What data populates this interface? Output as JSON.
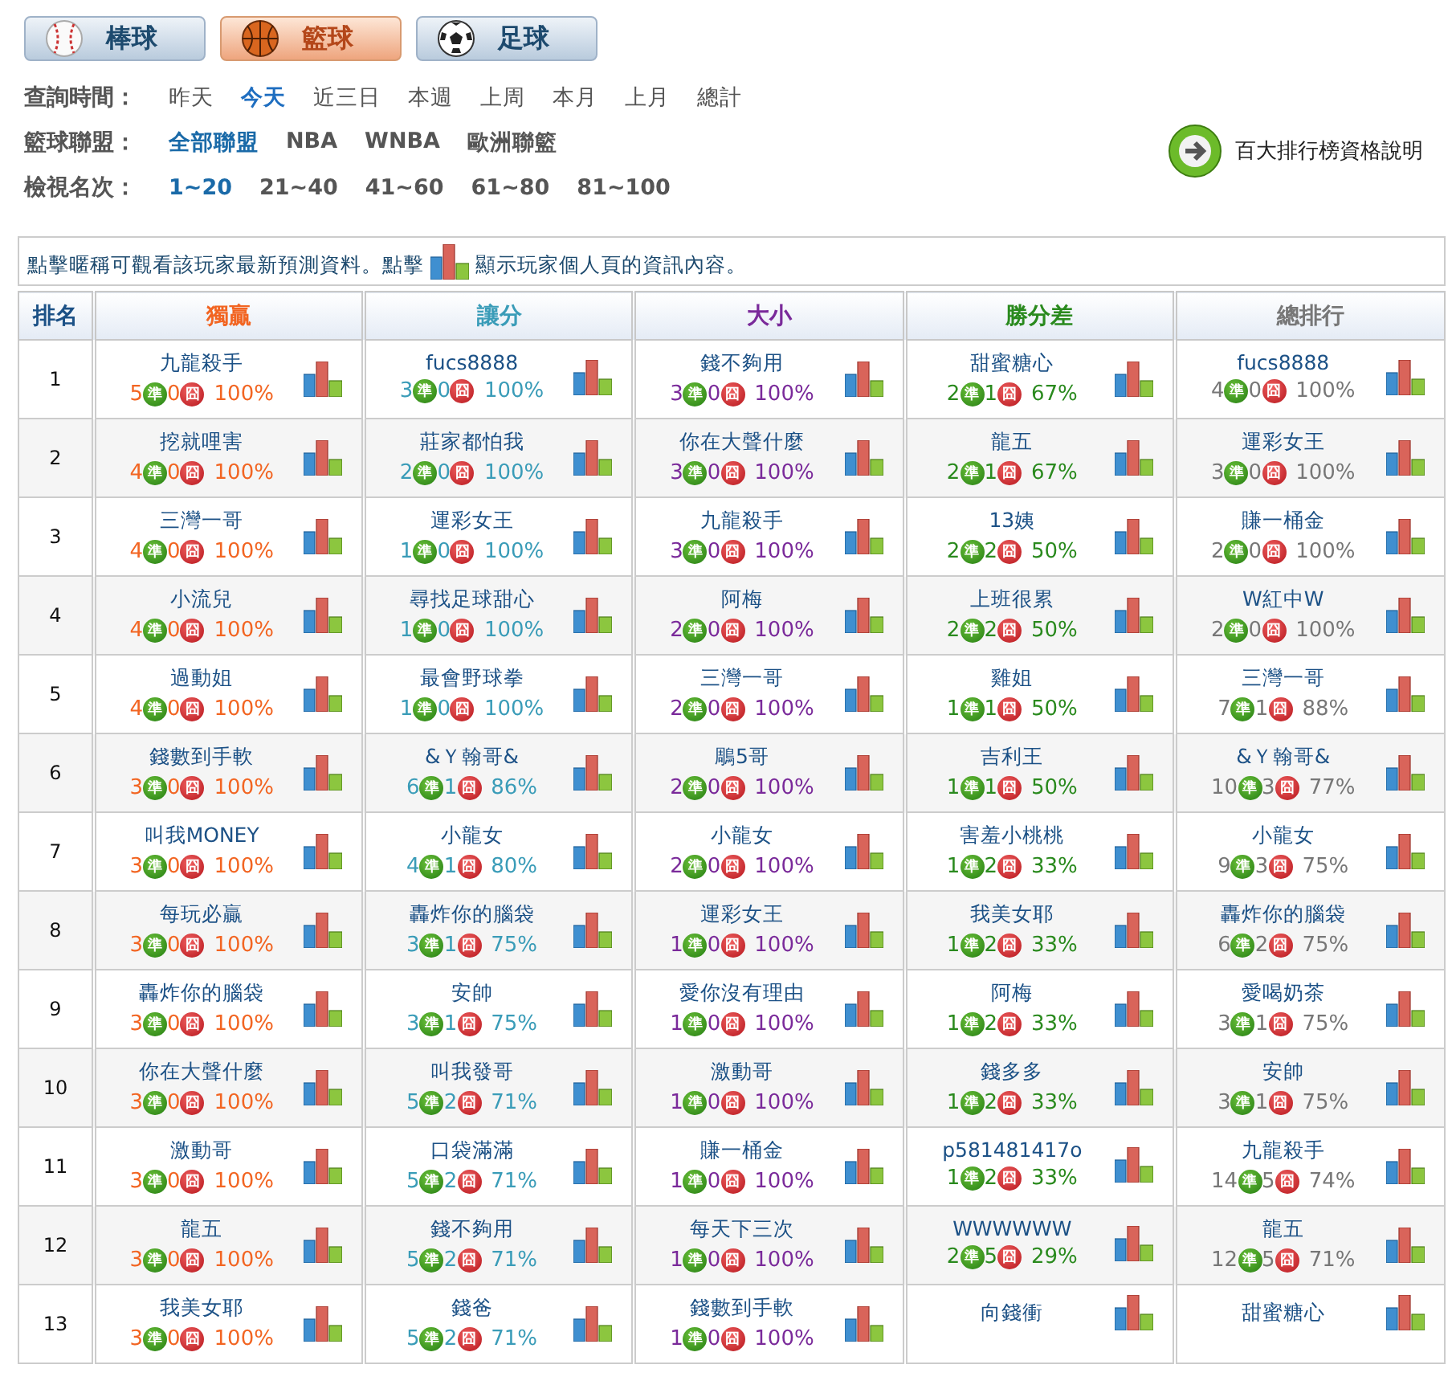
{
  "sport_tabs": [
    {
      "label": "棒球",
      "kind": "baseball",
      "selected": false
    },
    {
      "label": "籃球",
      "kind": "basketball",
      "selected": true
    },
    {
      "label": "足球",
      "kind": "soccer",
      "selected": false
    }
  ],
  "filters": [
    {
      "label": "查詢時間：",
      "kind": "plain",
      "options": [
        {
          "text": "昨天",
          "selected": false
        },
        {
          "text": "今天",
          "selected": true
        },
        {
          "text": "近三日",
          "selected": false
        },
        {
          "text": "本週",
          "selected": false
        },
        {
          "text": "上周",
          "selected": false
        },
        {
          "text": "本月",
          "selected": false
        },
        {
          "text": "上月",
          "selected": false
        },
        {
          "text": "總計",
          "selected": false
        }
      ]
    },
    {
      "label": "籃球聯盟：",
      "kind": "bold",
      "options": [
        {
          "text": "全部聯盟",
          "selected": true
        },
        {
          "text": "NBA",
          "selected": false
        },
        {
          "text": "WNBA",
          "selected": false
        },
        {
          "text": "歐洲聯籃",
          "selected": false
        }
      ]
    },
    {
      "label": "檢視名次：",
      "kind": "bold",
      "options": [
        {
          "text": "1~20",
          "selected": true
        },
        {
          "text": "21~40",
          "selected": false
        },
        {
          "text": "41~60",
          "selected": false
        },
        {
          "text": "61~80",
          "selected": false
        },
        {
          "text": "81~100",
          "selected": false
        }
      ]
    }
  ],
  "info_link": "百大排行榜資格說明",
  "notice": {
    "before": "點擊暱稱可觀看該玩家最新預測資料。點擊",
    "after": "顯示玩家個人頁的資訊內容。"
  },
  "table": {
    "rank_header": "排名",
    "columns": [
      {
        "title": "獨贏",
        "color": "#f26522"
      },
      {
        "title": "讓分",
        "color": "#3a9cb8"
      },
      {
        "title": "大小",
        "color": "#7a2a9a"
      },
      {
        "title": "勝分差",
        "color": "#2a8a1e"
      },
      {
        "title": "總排行",
        "color": "#777777"
      }
    ],
    "rows": [
      {
        "rank": "1",
        "cells": [
          {
            "name": "九龍殺手",
            "win": "5",
            "win_mark": "準",
            "loss": "0",
            "loss_mark": "囧",
            "pct": "100%"
          },
          {
            "name": "fucs8888",
            "win": "3",
            "win_mark": "準",
            "loss": "0",
            "loss_mark": "囧",
            "pct": "100%"
          },
          {
            "name": "錢不夠用",
            "win": "3",
            "win_mark": "準",
            "loss": "0",
            "loss_mark": "囧",
            "pct": "100%"
          },
          {
            "name": "甜蜜糖心",
            "win": "2",
            "win_mark": "準",
            "loss": "1",
            "loss_mark": "囧",
            "pct": "67%"
          },
          {
            "name": "fucs8888",
            "win": "4",
            "win_mark": "準",
            "loss": "0",
            "loss_mark": "囧",
            "pct": "100%"
          }
        ]
      },
      {
        "rank": "2",
        "cells": [
          {
            "name": "挖就哩害",
            "win": "4",
            "win_mark": "準",
            "loss": "0",
            "loss_mark": "囧",
            "pct": "100%"
          },
          {
            "name": "莊家都怕我",
            "win": "2",
            "win_mark": "準",
            "loss": "0",
            "loss_mark": "囧",
            "pct": "100%"
          },
          {
            "name": "你在大聲什麼",
            "win": "3",
            "win_mark": "準",
            "loss": "0",
            "loss_mark": "囧",
            "pct": "100%"
          },
          {
            "name": "龍五",
            "win": "2",
            "win_mark": "準",
            "loss": "1",
            "loss_mark": "囧",
            "pct": "67%"
          },
          {
            "name": "運彩女王",
            "win": "3",
            "win_mark": "準",
            "loss": "0",
            "loss_mark": "囧",
            "pct": "100%"
          }
        ]
      },
      {
        "rank": "3",
        "cells": [
          {
            "name": "三灣一哥",
            "win": "4",
            "win_mark": "準",
            "loss": "0",
            "loss_mark": "囧",
            "pct": "100%"
          },
          {
            "name": "運彩女王",
            "win": "1",
            "win_mark": "準",
            "loss": "0",
            "loss_mark": "囧",
            "pct": "100%"
          },
          {
            "name": "九龍殺手",
            "win": "3",
            "win_mark": "準",
            "loss": "0",
            "loss_mark": "囧",
            "pct": "100%"
          },
          {
            "name": "13姨",
            "win": "2",
            "win_mark": "準",
            "loss": "2",
            "loss_mark": "囧",
            "pct": "50%"
          },
          {
            "name": "賺一桶金",
            "win": "2",
            "win_mark": "準",
            "loss": "0",
            "loss_mark": "囧",
            "pct": "100%"
          }
        ]
      },
      {
        "rank": "4",
        "cells": [
          {
            "name": "小流兒",
            "win": "4",
            "win_mark": "準",
            "loss": "0",
            "loss_mark": "囧",
            "pct": "100%"
          },
          {
            "name": "尋找足球甜心",
            "win": "1",
            "win_mark": "準",
            "loss": "0",
            "loss_mark": "囧",
            "pct": "100%"
          },
          {
            "name": "阿梅",
            "win": "2",
            "win_mark": "準",
            "loss": "0",
            "loss_mark": "囧",
            "pct": "100%"
          },
          {
            "name": "上班很累",
            "win": "2",
            "win_mark": "準",
            "loss": "2",
            "loss_mark": "囧",
            "pct": "50%"
          },
          {
            "name": "W紅中W",
            "win": "2",
            "win_mark": "準",
            "loss": "0",
            "loss_mark": "囧",
            "pct": "100%"
          }
        ]
      },
      {
        "rank": "5",
        "cells": [
          {
            "name": "過動姐",
            "win": "4",
            "win_mark": "準",
            "loss": "0",
            "loss_mark": "囧",
            "pct": "100%"
          },
          {
            "name": "最會野球拳",
            "win": "1",
            "win_mark": "準",
            "loss": "0",
            "loss_mark": "囧",
            "pct": "100%"
          },
          {
            "name": "三灣一哥",
            "win": "2",
            "win_mark": "準",
            "loss": "0",
            "loss_mark": "囧",
            "pct": "100%"
          },
          {
            "name": "雞姐",
            "win": "1",
            "win_mark": "準",
            "loss": "1",
            "loss_mark": "囧",
            "pct": "50%"
          },
          {
            "name": "三灣一哥",
            "win": "7",
            "win_mark": "準",
            "loss": "1",
            "loss_mark": "囧",
            "pct": "88%"
          }
        ]
      },
      {
        "rank": "6",
        "cells": [
          {
            "name": "錢數到手軟",
            "win": "3",
            "win_mark": "準",
            "loss": "0",
            "loss_mark": "囧",
            "pct": "100%"
          },
          {
            "name": "&Ｙ翰哥&",
            "win": "6",
            "win_mark": "準",
            "loss": "1",
            "loss_mark": "囧",
            "pct": "86%"
          },
          {
            "name": "鵰5哥",
            "win": "2",
            "win_mark": "準",
            "loss": "0",
            "loss_mark": "囧",
            "pct": "100%"
          },
          {
            "name": "吉利王",
            "win": "1",
            "win_mark": "準",
            "loss": "1",
            "loss_mark": "囧",
            "pct": "50%"
          },
          {
            "name": "&Ｙ翰哥&",
            "win": "10",
            "win_mark": "準",
            "loss": "3",
            "loss_mark": "囧",
            "pct": "77%"
          }
        ]
      },
      {
        "rank": "7",
        "cells": [
          {
            "name": "叫我MONEY",
            "win": "3",
            "win_mark": "準",
            "loss": "0",
            "loss_mark": "囧",
            "pct": "100%"
          },
          {
            "name": "小龍女",
            "win": "4",
            "win_mark": "準",
            "loss": "1",
            "loss_mark": "囧",
            "pct": "80%"
          },
          {
            "name": "小龍女",
            "win": "2",
            "win_mark": "準",
            "loss": "0",
            "loss_mark": "囧",
            "pct": "100%"
          },
          {
            "name": "害羞小桃桃",
            "win": "1",
            "win_mark": "準",
            "loss": "2",
            "loss_mark": "囧",
            "pct": "33%"
          },
          {
            "name": "小龍女",
            "win": "9",
            "win_mark": "準",
            "loss": "3",
            "loss_mark": "囧",
            "pct": "75%"
          }
        ]
      },
      {
        "rank": "8",
        "cells": [
          {
            "name": "每玩必贏",
            "win": "3",
            "win_mark": "準",
            "loss": "0",
            "loss_mark": "囧",
            "pct": "100%"
          },
          {
            "name": "轟炸你的腦袋",
            "win": "3",
            "win_mark": "準",
            "loss": "1",
            "loss_mark": "囧",
            "pct": "75%"
          },
          {
            "name": "運彩女王",
            "win": "1",
            "win_mark": "準",
            "loss": "0",
            "loss_mark": "囧",
            "pct": "100%"
          },
          {
            "name": "我美女耶",
            "win": "1",
            "win_mark": "準",
            "loss": "2",
            "loss_mark": "囧",
            "pct": "33%"
          },
          {
            "name": "轟炸你的腦袋",
            "win": "6",
            "win_mark": "準",
            "loss": "2",
            "loss_mark": "囧",
            "pct": "75%"
          }
        ]
      },
      {
        "rank": "9",
        "cells": [
          {
            "name": "轟炸你的腦袋",
            "win": "3",
            "win_mark": "準",
            "loss": "0",
            "loss_mark": "囧",
            "pct": "100%"
          },
          {
            "name": "安帥",
            "win": "3",
            "win_mark": "準",
            "loss": "1",
            "loss_mark": "囧",
            "pct": "75%"
          },
          {
            "name": "愛你沒有理由",
            "win": "1",
            "win_mark": "準",
            "loss": "0",
            "loss_mark": "囧",
            "pct": "100%"
          },
          {
            "name": "阿梅",
            "win": "1",
            "win_mark": "準",
            "loss": "2",
            "loss_mark": "囧",
            "pct": "33%"
          },
          {
            "name": "愛喝奶茶",
            "win": "3",
            "win_mark": "準",
            "loss": "1",
            "loss_mark": "囧",
            "pct": "75%"
          }
        ]
      },
      {
        "rank": "10",
        "cells": [
          {
            "name": "你在大聲什麼",
            "win": "3",
            "win_mark": "準",
            "loss": "0",
            "loss_mark": "囧",
            "pct": "100%"
          },
          {
            "name": "叫我發哥",
            "win": "5",
            "win_mark": "準",
            "loss": "2",
            "loss_mark": "囧",
            "pct": "71%"
          },
          {
            "name": "激動哥",
            "win": "1",
            "win_mark": "準",
            "loss": "0",
            "loss_mark": "囧",
            "pct": "100%"
          },
          {
            "name": "錢多多",
            "win": "1",
            "win_mark": "準",
            "loss": "2",
            "loss_mark": "囧",
            "pct": "33%"
          },
          {
            "name": "安帥",
            "win": "3",
            "win_mark": "準",
            "loss": "1",
            "loss_mark": "囧",
            "pct": "75%"
          }
        ]
      },
      {
        "rank": "11",
        "cells": [
          {
            "name": "激動哥",
            "win": "3",
            "win_mark": "準",
            "loss": "0",
            "loss_mark": "囧",
            "pct": "100%"
          },
          {
            "name": "口袋滿滿",
            "win": "5",
            "win_mark": "準",
            "loss": "2",
            "loss_mark": "囧",
            "pct": "71%"
          },
          {
            "name": "賺一桶金",
            "win": "1",
            "win_mark": "準",
            "loss": "0",
            "loss_mark": "囧",
            "pct": "100%"
          },
          {
            "name": "p581481417o",
            "win": "1",
            "win_mark": "準",
            "loss": "2",
            "loss_mark": "囧",
            "pct": "33%"
          },
          {
            "name": "九龍殺手",
            "win": "14",
            "win_mark": "準",
            "loss": "5",
            "loss_mark": "囧",
            "pct": "74%"
          }
        ]
      },
      {
        "rank": "12",
        "cells": [
          {
            "name": "龍五",
            "win": "3",
            "win_mark": "準",
            "loss": "0",
            "loss_mark": "囧",
            "pct": "100%"
          },
          {
            "name": "錢不夠用",
            "win": "5",
            "win_mark": "準",
            "loss": "2",
            "loss_mark": "囧",
            "pct": "71%"
          },
          {
            "name": "每天下三次",
            "win": "1",
            "win_mark": "準",
            "loss": "0",
            "loss_mark": "囧",
            "pct": "100%"
          },
          {
            "name": "WWWWWW",
            "win": "2",
            "win_mark": "準",
            "loss": "5",
            "loss_mark": "囧",
            "pct": "29%"
          },
          {
            "name": "龍五",
            "win": "12",
            "win_mark": "準",
            "loss": "5",
            "loss_mark": "囧",
            "pct": "71%"
          }
        ]
      },
      {
        "rank": "13",
        "cells": [
          {
            "name": "我美女耶",
            "win": "3",
            "win_mark": "準",
            "loss": "0",
            "loss_mark": "囧",
            "pct": "100%"
          },
          {
            "name": "錢爸",
            "win": "5",
            "win_mark": "準",
            "loss": "2",
            "loss_mark": "囧",
            "pct": "71%"
          },
          {
            "name": "錢數到手軟",
            "win": "1",
            "win_mark": "準",
            "loss": "0",
            "loss_mark": "囧",
            "pct": "100%"
          },
          {
            "name": "向錢衝"
          },
          {
            "name": "甜蜜糖心"
          }
        ]
      }
    ]
  }
}
